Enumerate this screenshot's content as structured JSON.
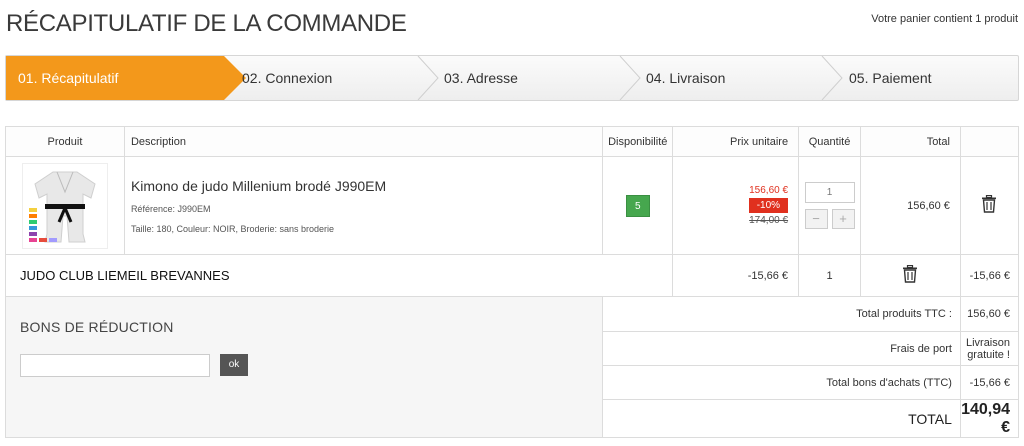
{
  "header": {
    "title": "RÉCAPITULATIF DE LA COMMANDE",
    "cart_summary": "Votre panier contient 1 produit"
  },
  "steps": [
    {
      "label": "01. Récapitulatif",
      "active": true
    },
    {
      "label": "02. Connexion",
      "active": false
    },
    {
      "label": "03. Adresse",
      "active": false
    },
    {
      "label": "04. Livraison",
      "active": false
    },
    {
      "label": "05. Paiement",
      "active": false
    }
  ],
  "table": {
    "headers": {
      "product": "Produit",
      "description": "Description",
      "availability": "Disponibilité",
      "unit_price": "Prix unitaire",
      "quantity": "Quantité",
      "total": "Total"
    },
    "product": {
      "name": "Kimono de judo Millenium brodé J990EM",
      "reference": "Référence: J990EM",
      "attributes": "Taille: 180, Couleur: NOIR, Broderie: sans broderie",
      "stock": "5",
      "price_new": "156,60 €",
      "discount": "-10%",
      "price_old": "174,00 €",
      "quantity": "1",
      "total": "156,60 €"
    },
    "voucher_line": {
      "name": "JUDO CLUB LIEMEIL BREVANNES",
      "unit_price": "-15,66 €",
      "quantity": "1",
      "total": "-15,66 €"
    }
  },
  "vouchers": {
    "title": "BONS DE RÉDUCTION",
    "input_value": "",
    "ok_label": "ok"
  },
  "totals": {
    "products_label": "Total produits TTC :",
    "products_value": "156,60 €",
    "shipping_label": "Frais de port",
    "shipping_value": "Livraison gratuite !",
    "vouchers_label": "Total bons d'achats (TTC)",
    "vouchers_value": "-15,66 €",
    "total_label": "TOTAL",
    "total_value": "140,94 €"
  },
  "colors": {
    "accent": "#f3981b",
    "stock_green": "#46a74e",
    "discount_red": "#e0301e"
  }
}
